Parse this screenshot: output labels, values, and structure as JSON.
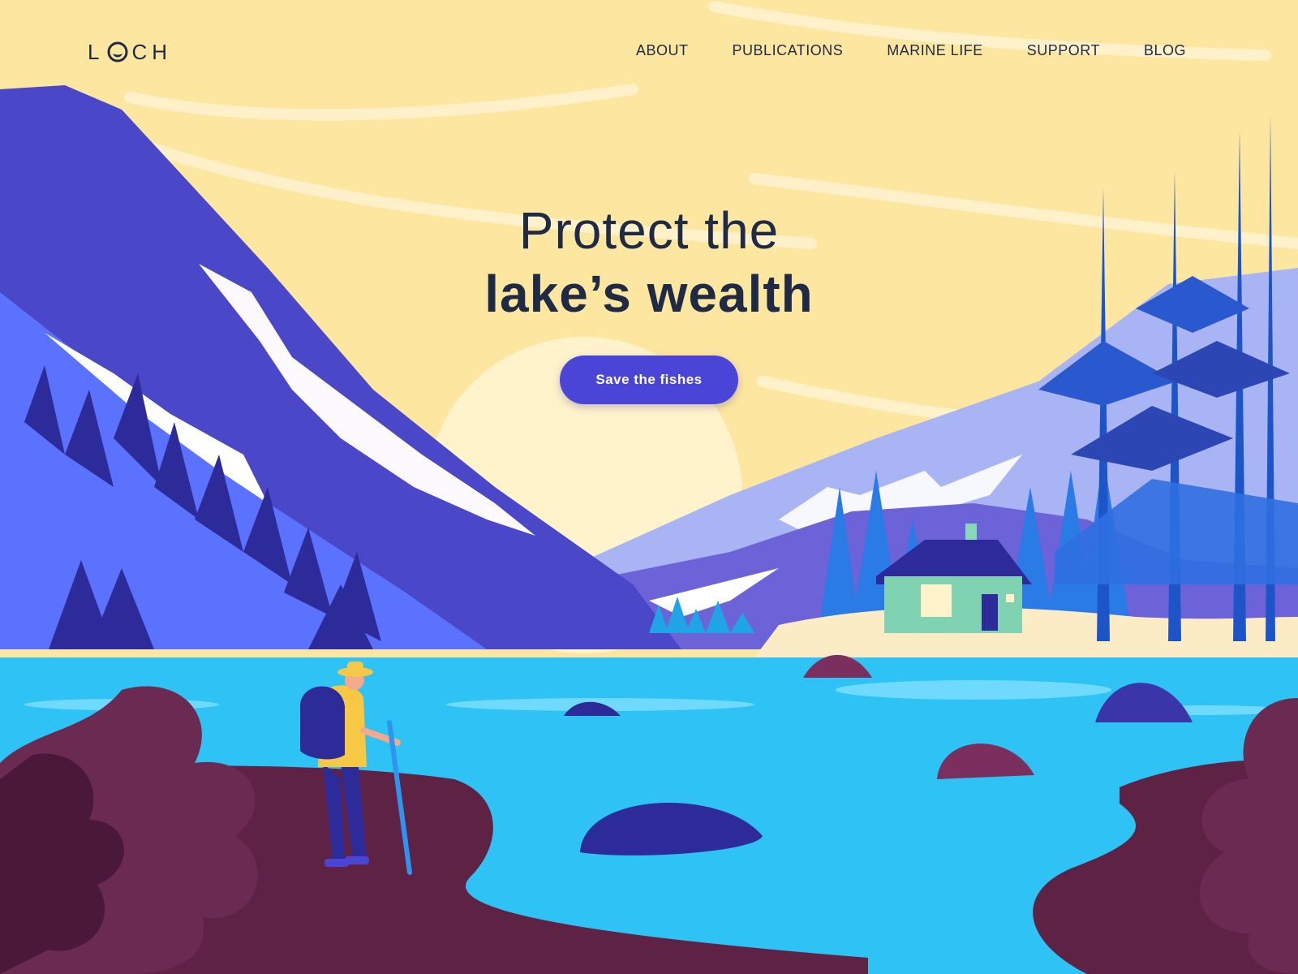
{
  "brand": {
    "logo_text_start": "L",
    "logo_text_end": "CH"
  },
  "nav": {
    "items": [
      {
        "label": "ABOUT"
      },
      {
        "label": "PUBLICATIONS"
      },
      {
        "label": "MARINE LIFE"
      },
      {
        "label": "SUPPORT"
      },
      {
        "label": "BLOG"
      }
    ]
  },
  "hero": {
    "headline_line1": "Protect the",
    "headline_line2": "lake’s wealth",
    "cta_label": "Save the fishes"
  },
  "colors": {
    "sky": "#fde7a0",
    "text_dark": "#1f2a44",
    "cta": "#4a45d6",
    "water": "#2fc2f4",
    "mountain": "#4a47c8",
    "shore": "#5e2244"
  },
  "illustration": {
    "icons": [
      "mountains",
      "pine-trees",
      "cabin",
      "hiker",
      "lake",
      "rocks",
      "leaves",
      "sun"
    ]
  }
}
